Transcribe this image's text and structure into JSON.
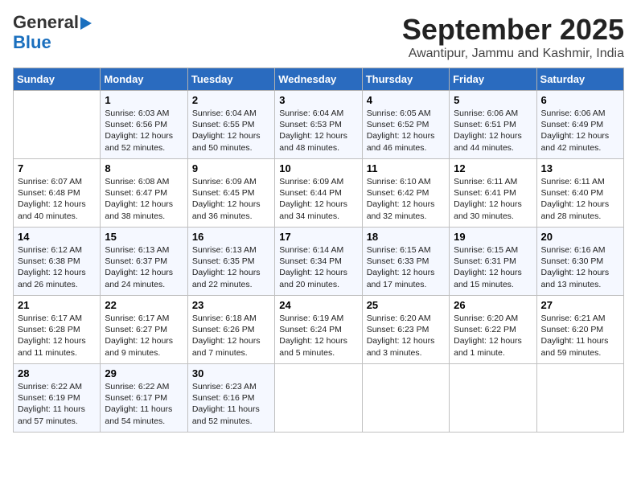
{
  "logo": {
    "line1": "General",
    "line2": "Blue"
  },
  "header": {
    "month": "September 2025",
    "location": "Awantipur, Jammu and Kashmir, India"
  },
  "weekdays": [
    "Sunday",
    "Monday",
    "Tuesday",
    "Wednesday",
    "Thursday",
    "Friday",
    "Saturday"
  ],
  "weeks": [
    [
      {
        "day": "",
        "info": ""
      },
      {
        "day": "1",
        "info": "Sunrise: 6:03 AM\nSunset: 6:56 PM\nDaylight: 12 hours\nand 52 minutes."
      },
      {
        "day": "2",
        "info": "Sunrise: 6:04 AM\nSunset: 6:55 PM\nDaylight: 12 hours\nand 50 minutes."
      },
      {
        "day": "3",
        "info": "Sunrise: 6:04 AM\nSunset: 6:53 PM\nDaylight: 12 hours\nand 48 minutes."
      },
      {
        "day": "4",
        "info": "Sunrise: 6:05 AM\nSunset: 6:52 PM\nDaylight: 12 hours\nand 46 minutes."
      },
      {
        "day": "5",
        "info": "Sunrise: 6:06 AM\nSunset: 6:51 PM\nDaylight: 12 hours\nand 44 minutes."
      },
      {
        "day": "6",
        "info": "Sunrise: 6:06 AM\nSunset: 6:49 PM\nDaylight: 12 hours\nand 42 minutes."
      }
    ],
    [
      {
        "day": "7",
        "info": "Sunrise: 6:07 AM\nSunset: 6:48 PM\nDaylight: 12 hours\nand 40 minutes."
      },
      {
        "day": "8",
        "info": "Sunrise: 6:08 AM\nSunset: 6:47 PM\nDaylight: 12 hours\nand 38 minutes."
      },
      {
        "day": "9",
        "info": "Sunrise: 6:09 AM\nSunset: 6:45 PM\nDaylight: 12 hours\nand 36 minutes."
      },
      {
        "day": "10",
        "info": "Sunrise: 6:09 AM\nSunset: 6:44 PM\nDaylight: 12 hours\nand 34 minutes."
      },
      {
        "day": "11",
        "info": "Sunrise: 6:10 AM\nSunset: 6:42 PM\nDaylight: 12 hours\nand 32 minutes."
      },
      {
        "day": "12",
        "info": "Sunrise: 6:11 AM\nSunset: 6:41 PM\nDaylight: 12 hours\nand 30 minutes."
      },
      {
        "day": "13",
        "info": "Sunrise: 6:11 AM\nSunset: 6:40 PM\nDaylight: 12 hours\nand 28 minutes."
      }
    ],
    [
      {
        "day": "14",
        "info": "Sunrise: 6:12 AM\nSunset: 6:38 PM\nDaylight: 12 hours\nand 26 minutes."
      },
      {
        "day": "15",
        "info": "Sunrise: 6:13 AM\nSunset: 6:37 PM\nDaylight: 12 hours\nand 24 minutes."
      },
      {
        "day": "16",
        "info": "Sunrise: 6:13 AM\nSunset: 6:35 PM\nDaylight: 12 hours\nand 22 minutes."
      },
      {
        "day": "17",
        "info": "Sunrise: 6:14 AM\nSunset: 6:34 PM\nDaylight: 12 hours\nand 20 minutes."
      },
      {
        "day": "18",
        "info": "Sunrise: 6:15 AM\nSunset: 6:33 PM\nDaylight: 12 hours\nand 17 minutes."
      },
      {
        "day": "19",
        "info": "Sunrise: 6:15 AM\nSunset: 6:31 PM\nDaylight: 12 hours\nand 15 minutes."
      },
      {
        "day": "20",
        "info": "Sunrise: 6:16 AM\nSunset: 6:30 PM\nDaylight: 12 hours\nand 13 minutes."
      }
    ],
    [
      {
        "day": "21",
        "info": "Sunrise: 6:17 AM\nSunset: 6:28 PM\nDaylight: 12 hours\nand 11 minutes."
      },
      {
        "day": "22",
        "info": "Sunrise: 6:17 AM\nSunset: 6:27 PM\nDaylight: 12 hours\nand 9 minutes."
      },
      {
        "day": "23",
        "info": "Sunrise: 6:18 AM\nSunset: 6:26 PM\nDaylight: 12 hours\nand 7 minutes."
      },
      {
        "day": "24",
        "info": "Sunrise: 6:19 AM\nSunset: 6:24 PM\nDaylight: 12 hours\nand 5 minutes."
      },
      {
        "day": "25",
        "info": "Sunrise: 6:20 AM\nSunset: 6:23 PM\nDaylight: 12 hours\nand 3 minutes."
      },
      {
        "day": "26",
        "info": "Sunrise: 6:20 AM\nSunset: 6:22 PM\nDaylight: 12 hours\nand 1 minute."
      },
      {
        "day": "27",
        "info": "Sunrise: 6:21 AM\nSunset: 6:20 PM\nDaylight: 11 hours\nand 59 minutes."
      }
    ],
    [
      {
        "day": "28",
        "info": "Sunrise: 6:22 AM\nSunset: 6:19 PM\nDaylight: 11 hours\nand 57 minutes."
      },
      {
        "day": "29",
        "info": "Sunrise: 6:22 AM\nSunset: 6:17 PM\nDaylight: 11 hours\nand 54 minutes."
      },
      {
        "day": "30",
        "info": "Sunrise: 6:23 AM\nSunset: 6:16 PM\nDaylight: 11 hours\nand 52 minutes."
      },
      {
        "day": "",
        "info": ""
      },
      {
        "day": "",
        "info": ""
      },
      {
        "day": "",
        "info": ""
      },
      {
        "day": "",
        "info": ""
      }
    ]
  ]
}
